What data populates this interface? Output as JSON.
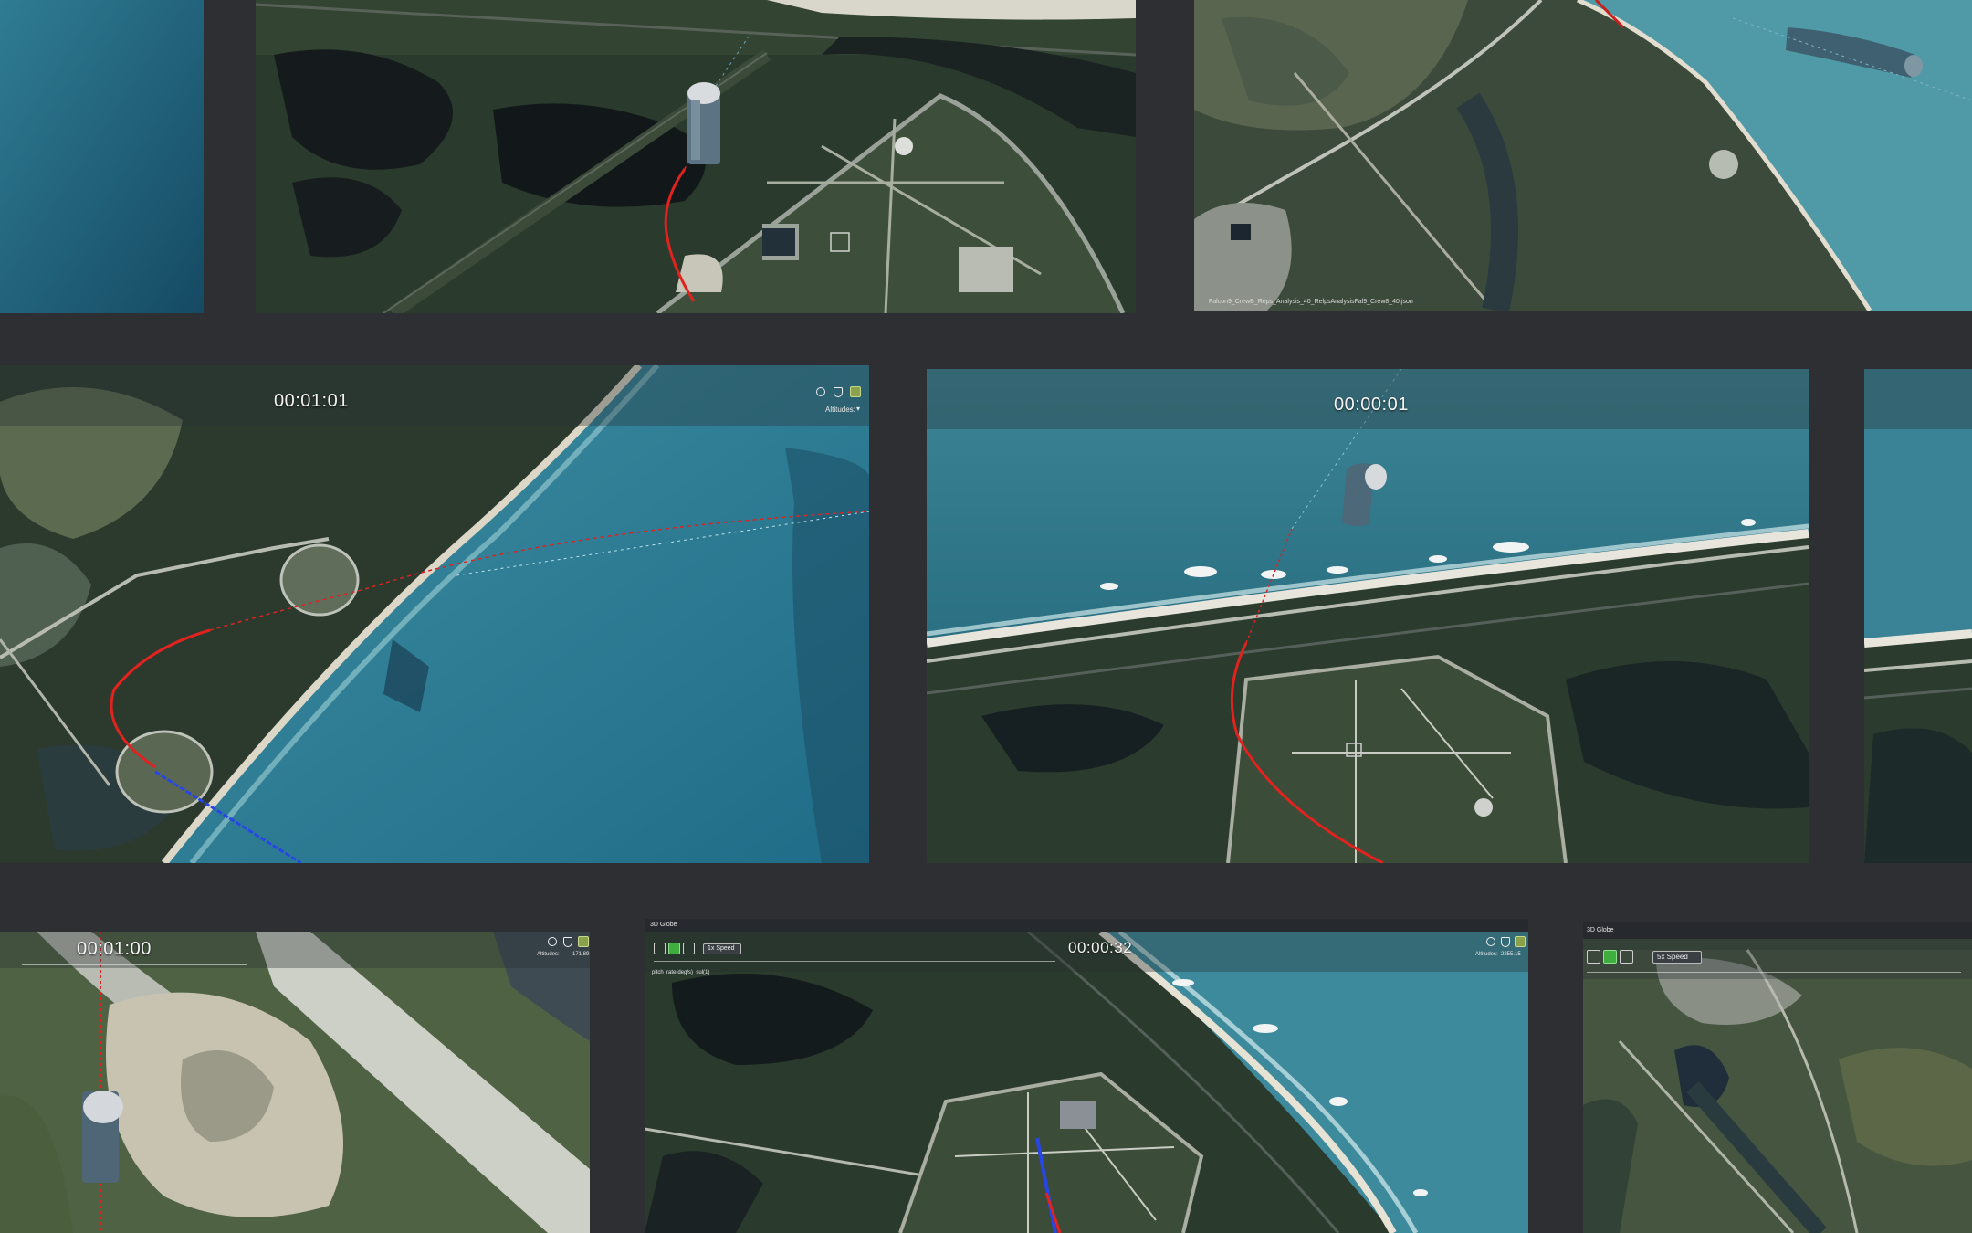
{
  "tiles": {
    "top_center": {
      "timer": ""
    },
    "top_right": {
      "filename": "Falcon9_CrewB_Reps_Analysis_40_RelpsAnalysisFal9_Crew8_40.json"
    },
    "mid_left": {
      "timer": "00:01:01",
      "altitudes_label": "Altitudes:"
    },
    "mid_center": {
      "timer": "00:00:01"
    },
    "bottom_left": {
      "timer": "00:01:00",
      "altitudes_label": "Altitudes:",
      "altitudes_value": "171.89"
    },
    "bottom_center": {
      "header": "3D Globe",
      "timer": "00:00:32",
      "speed": "1x Speed",
      "readout": "pitch_rate(deg/s)_sul(1)",
      "altitudes_label": "Altitudes:",
      "altitudes_value": "2255.15"
    },
    "bottom_right": {
      "header": "3D Globe",
      "speed": "5x Speed"
    }
  },
  "icons": [
    "globe-icon",
    "shield-icon",
    "image-layer-icon",
    "step-back-icon",
    "pause-icon",
    "play-icon",
    "chevron-down-icon"
  ],
  "colors": {
    "background": "#2e2f33",
    "trajectory_red": "#e0231f",
    "trajectory_blue": "#2846e6",
    "ocean": "#2d6f85",
    "play_green": "#3fae3f"
  }
}
